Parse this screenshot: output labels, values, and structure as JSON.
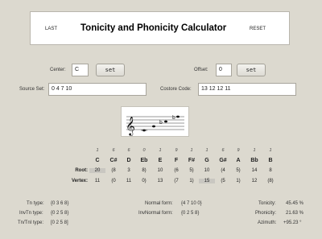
{
  "header": {
    "last_label": "LAST",
    "title": "Tonicity and Phonicity Calculator",
    "reset_label": "RESET"
  },
  "center": {
    "label": "Center:",
    "value": "C",
    "set_label": "set"
  },
  "offset": {
    "label": "Offset:",
    "value": "0",
    "set_label": "set"
  },
  "source_set": {
    "label": "Source Set:",
    "value": "0 4 7 10"
  },
  "costore_code": {
    "label": "Costore Code:",
    "value": "13 12 12 11"
  },
  "grid": {
    "top_numbers": [
      "1",
      "6",
      "6",
      "0",
      "1",
      "9",
      "1",
      "1",
      "6",
      "9",
      "1",
      "1"
    ],
    "notes": [
      "C",
      "C#",
      "D",
      "Eb",
      "E",
      "F",
      "F#",
      "G",
      "G#",
      "A",
      "Bb",
      "B"
    ],
    "root_label": "Root:",
    "root_values": [
      "20",
      "(8",
      "3",
      "8)",
      "10",
      "(6",
      "5)",
      "10",
      "(4",
      "5)",
      "14",
      "8"
    ],
    "vertex_label": "Vertex:",
    "vertex_values": [
      "11",
      "(0",
      "11",
      "0)",
      "13",
      "(7",
      "1)",
      "15",
      "(5",
      "1)",
      "12",
      "(8)"
    ]
  },
  "forms": {
    "tn_type_label": "Tn type:",
    "tn_type_value": "{0 3 6 8}",
    "tnl_type_label": "InvTn type:",
    "tnl_type_value": "{0 2 5 8}",
    "tntnl_type_label": "Tn/TnI type:",
    "tntnl_type_value": "[0 2 5 8]",
    "normal_label": "Normal form:",
    "normal_value": "{4 7 10 0}",
    "invnormal_label": "InvNormal form:",
    "invnormal_value": "{0 2 5 8}"
  },
  "stats": {
    "tonicity_label": "Tonicity:",
    "tonicity_value": "45.45 %",
    "phonicity_label": "Phonicity:",
    "phonicity_value": "21.63 %",
    "azimuth_label": "Azimuth:",
    "azimuth_value": "+95.23 °"
  }
}
